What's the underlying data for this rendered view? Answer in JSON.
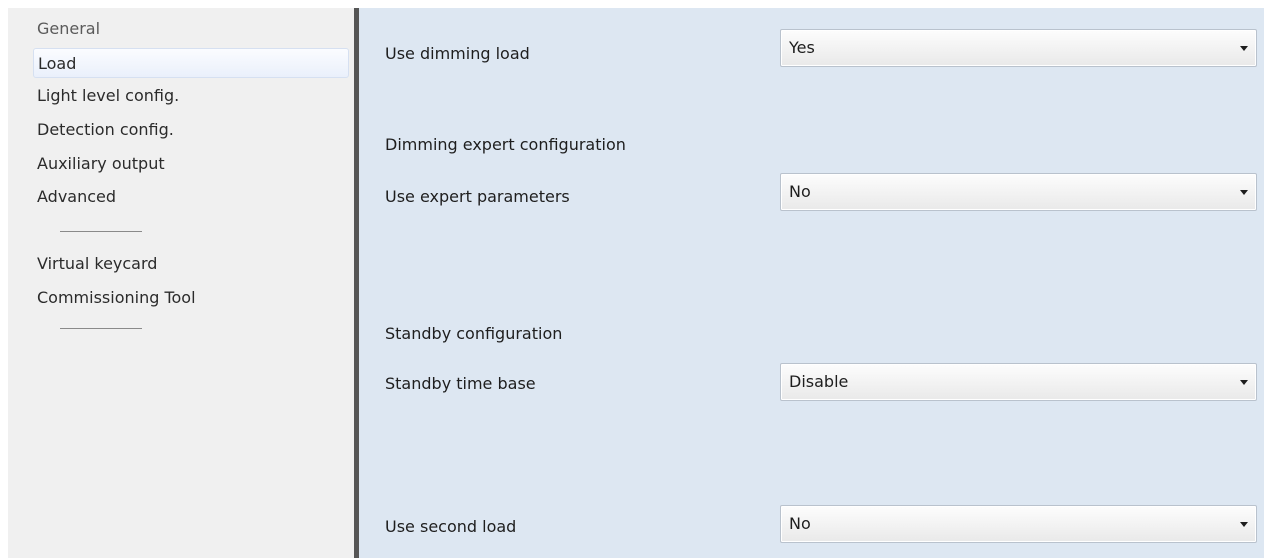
{
  "sidebar": {
    "items": [
      {
        "label": "General"
      },
      {
        "label": "Load"
      },
      {
        "label": "Light level config."
      },
      {
        "label": "Detection config."
      },
      {
        "label": "Auxiliary output"
      },
      {
        "label": "Advanced"
      },
      {
        "label": "Virtual keycard"
      },
      {
        "label": "Commissioning Tool"
      }
    ],
    "selected": "Load"
  },
  "panel": {
    "use_dimming_load": {
      "label": "Use dimming load",
      "value": "Yes"
    },
    "dimming_expert_title": "Dimming expert configuration",
    "use_expert_parameters": {
      "label": "Use expert parameters",
      "value": "No"
    },
    "standby_title": "Standby configuration",
    "standby_time_base": {
      "label": "Standby time base",
      "value": "Disable"
    },
    "use_second_load": {
      "label": "Use second load",
      "value": "No"
    }
  },
  "icons": {
    "dropdown_arrow": "chevron-down-icon"
  },
  "colors": {
    "sidebar_bg": "#f0f0f0",
    "panel_bg": "#dde7f2",
    "divider": "#555555",
    "selection_bg": "#eaf0fb"
  }
}
